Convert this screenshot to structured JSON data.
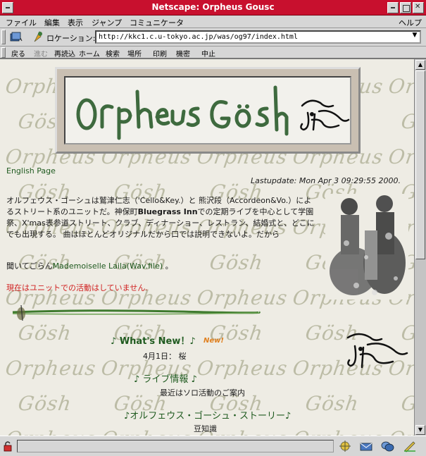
{
  "window": {
    "title": "Netscape: Orpheus Gousⅽ"
  },
  "menu": {
    "items": [
      "ファイル",
      "編集",
      "表示",
      "ジャンプ",
      "コミュニケータ"
    ],
    "help": "ヘルプ"
  },
  "location": {
    "label": "ロケーション:",
    "url": "http://kkc1.c.u-tokyo.ac.jp/was/og97/index.html"
  },
  "nav": {
    "items": [
      "戻る",
      "進む",
      "再読込",
      "ホーム",
      "検索",
      "場所",
      "印刷",
      "機密",
      "中止"
    ]
  },
  "page": {
    "english_link": "English Page",
    "lastupdate": "Lastupdate: Mon Apr 3 09:29:55 2000.",
    "intro": "オルフェウス・ゴーシュは鷲津仁志（'Cello&Key.）と 熊沢段（Accordeon&Vo.）によるストリート系のユニットだ。神保町",
    "venue": "Bluegrass Inn",
    "intro_rest": "での定期ライブを中心として学園祭、X'mas表参道ストリート、クラブ、ディナーショー、レストラン、結婚式と、どこにでも出現する。 曲はほとんどオリジナルだから口では説明できないよ。だから",
    "listen_prefix": "聞いてごらん",
    "listen_link": "Mademoiselle Laila(Wav.file)",
    "listen_suffix": " 。",
    "notice": "現在はユニットでの活動はしていません.",
    "whats_new": "♪ What's New！♪",
    "new_badge": "New!",
    "date_entry": "4月1日： 桜",
    "live_info": "♪ ライブ情報 ♪",
    "live_sub": "最近はソロ活動のご案内",
    "story": "♪オルフェウス・ゴーシュ・ストーリー♪",
    "trivia": "豆知識"
  },
  "watermark": "Orpheus Gösh",
  "colors": {
    "titlebar": "#c8102e",
    "link_green": "#1f5a1f",
    "notice_red": "#d02020",
    "page_bg": "#eeece4"
  }
}
